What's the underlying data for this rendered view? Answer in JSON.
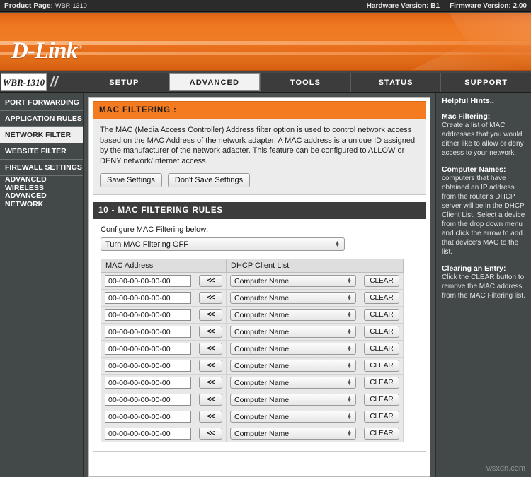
{
  "topbar": {
    "product_label": "Product Page:",
    "product_model": "WBR-1310",
    "hardware_version": "Hardware Version: B1",
    "firmware_version": "Firmware Version: 2.00"
  },
  "brand": {
    "logo": "D-Link",
    "trademark": "®"
  },
  "nav": {
    "model_badge": "WBR-1310",
    "tabs": [
      {
        "label": "SETUP",
        "active": false
      },
      {
        "label": "ADVANCED",
        "active": true
      },
      {
        "label": "TOOLS",
        "active": false
      },
      {
        "label": "STATUS",
        "active": false
      },
      {
        "label": "SUPPORT",
        "active": false
      }
    ]
  },
  "sidebar": {
    "items": [
      {
        "label": "PORT FORWARDING",
        "active": false
      },
      {
        "label": "APPLICATION RULES",
        "active": false
      },
      {
        "label": "NETWORK FILTER",
        "active": true
      },
      {
        "label": "WEBSITE FILTER",
        "active": false
      },
      {
        "label": "FIREWALL SETTINGS",
        "active": false
      },
      {
        "label": "ADVANCED WIRELESS",
        "active": false
      },
      {
        "label": "ADVANCED NETWORK",
        "active": false
      }
    ]
  },
  "main": {
    "section_title": "MAC FILTERING :",
    "description": "The MAC (Media Access Controller) Address filter option is used to control network access based on the MAC Address of the network adapter. A MAC address is a unique ID assigned by the manufacturer of the network adapter. This feature can be configured to ALLOW or DENY network/Internet access.",
    "save_label": "Save Settings",
    "dont_save_label": "Don't Save Settings",
    "rules_title": "10 - MAC FILTERING RULES",
    "configure_label": "Configure MAC Filtering below:",
    "mode_value": "Turn MAC Filtering OFF",
    "columns": [
      "MAC Address",
      "",
      "DHCP Client List",
      ""
    ],
    "arrow_label": "<<",
    "clear_label": "CLEAR",
    "rows": [
      {
        "mac": "00-00-00-00-00-00",
        "client": "Computer Name"
      },
      {
        "mac": "00-00-00-00-00-00",
        "client": "Computer Name"
      },
      {
        "mac": "00-00-00-00-00-00",
        "client": "Computer Name"
      },
      {
        "mac": "00-00-00-00-00-00",
        "client": "Computer Name"
      },
      {
        "mac": "00-00-00-00-00-00",
        "client": "Computer Name"
      },
      {
        "mac": "00-00-00-00-00-00",
        "client": "Computer Name"
      },
      {
        "mac": "00-00-00-00-00-00",
        "client": "Computer Name"
      },
      {
        "mac": "00-00-00-00-00-00",
        "client": "Computer Name"
      },
      {
        "mac": "00-00-00-00-00-00",
        "client": "Computer Name"
      },
      {
        "mac": "00-00-00-00-00-00",
        "client": "Computer Name"
      }
    ]
  },
  "hints": {
    "title": "Helpful Hints..",
    "blocks": [
      {
        "heading": "Mac Filtering:",
        "text": "Create a list of MAC addresses that you would either like to allow or deny access to your network."
      },
      {
        "heading": "Computer Names:",
        "text": "computers that have obtained an IP address from the router's DHCP server will be in the DHCP Client List. Select a device from the drop down menu and click the arrow to add that device's MAC to the list."
      },
      {
        "heading": "Clearing an Entry:",
        "text": "Click the CLEAR button to remove the MAC address from the MAC Filtering list."
      }
    ]
  },
  "watermark": "wsxdn.com",
  "colors": {
    "accent_orange": "#f47b20",
    "banner_orange": "#e4691a",
    "dark_chrome": "#434848",
    "nav_dark": "#3c3c3c"
  }
}
